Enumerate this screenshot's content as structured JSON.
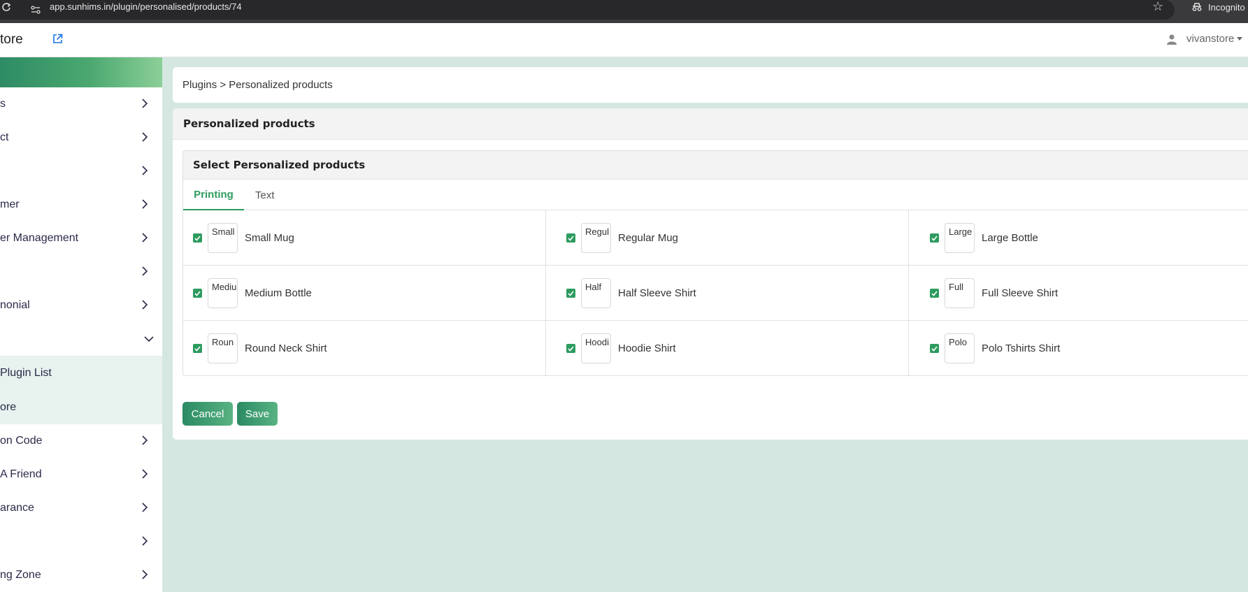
{
  "browser": {
    "url": "app.sunhims.in/plugin/personalised/products/74",
    "incognito_label": "Incognito"
  },
  "header": {
    "brand": "tore",
    "user_name": "vivanstore"
  },
  "sidebar": {
    "items": [
      {
        "label": "s"
      },
      {
        "label": "ct"
      },
      {
        "label": ""
      },
      {
        "label": "mer"
      },
      {
        "label": "er Management"
      },
      {
        "label": ""
      },
      {
        "label": "nonial"
      },
      {
        "label": ""
      }
    ],
    "subitems": [
      {
        "label": "Plugin List"
      },
      {
        "label": "ore"
      }
    ],
    "items_after": [
      {
        "label": "on Code"
      },
      {
        "label": "A Friend"
      },
      {
        "label": "arance"
      },
      {
        "label": ""
      },
      {
        "label": "ng Zone"
      }
    ]
  },
  "breadcrumb": "Plugins > Personalized products",
  "card": {
    "title": "Personalized products",
    "inner_title": "Select Personalized products",
    "tabs": [
      {
        "label": "Printing",
        "active": true
      },
      {
        "label": "Text",
        "active": false
      }
    ],
    "products": [
      {
        "name": "Small Mug",
        "alt": "Small",
        "checked": true
      },
      {
        "name": "Regular Mug",
        "alt": "Regul",
        "checked": true
      },
      {
        "name": "Large Bottle",
        "alt": "Large",
        "checked": true
      },
      {
        "name": "Medium Bottle",
        "alt": "Mediu",
        "checked": true
      },
      {
        "name": "Half Sleeve Shirt",
        "alt": "Half",
        "checked": true
      },
      {
        "name": "Full Sleeve Shirt",
        "alt": "Full",
        "checked": true
      },
      {
        "name": "Round Neck Shirt",
        "alt": "Roun",
        "checked": true
      },
      {
        "name": "Hoodie Shirt",
        "alt": "Hoodi",
        "checked": true
      },
      {
        "name": "Polo Tshirts Shirt",
        "alt": "Polo",
        "checked": true
      }
    ]
  },
  "actions": {
    "cancel_label": "Cancel",
    "save_label": "Save"
  },
  "colors": {
    "accent": "#2e9b5f",
    "background": "#d4e8e1"
  }
}
